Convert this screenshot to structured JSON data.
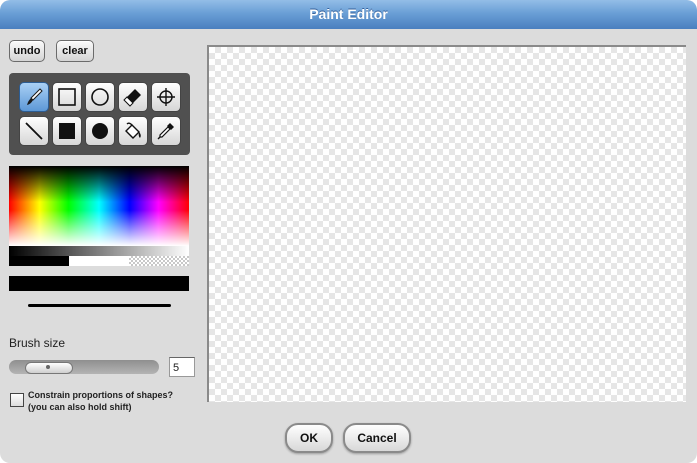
{
  "dialog": {
    "title": "Paint Editor"
  },
  "toolbar": {
    "undo_label": "undo",
    "clear_label": "clear"
  },
  "tools": [
    {
      "name": "brush",
      "icon": "brush-icon",
      "selected": true
    },
    {
      "name": "rectangle",
      "icon": "rectangle-outline-icon"
    },
    {
      "name": "ellipse",
      "icon": "ellipse-outline-icon"
    },
    {
      "name": "eraser",
      "icon": "eraser-icon"
    },
    {
      "name": "rotation-center",
      "icon": "crosshair-icon"
    },
    {
      "name": "line",
      "icon": "line-icon"
    },
    {
      "name": "filled-rectangle",
      "icon": "filled-rectangle-icon"
    },
    {
      "name": "filled-ellipse",
      "icon": "filled-ellipse-icon"
    },
    {
      "name": "paint-bucket",
      "icon": "paint-bucket-icon"
    },
    {
      "name": "eyedropper",
      "icon": "eyedropper-icon"
    }
  ],
  "palette": {
    "current_color": "#000000",
    "swatches": [
      "#000000",
      "#ffffff",
      "transparent"
    ]
  },
  "brush": {
    "label": "Brush size",
    "size": "5"
  },
  "constrain": {
    "label_line1": "Constrain proportions of shapes?",
    "label_line2": "(you can also hold shift)",
    "checked": false
  },
  "footer": {
    "ok_label": "OK",
    "cancel_label": "Cancel"
  },
  "colors": {
    "titlebar": "#6a9fd6",
    "dialog_background": "#dcdcdc",
    "selected_tool": "#5d98d6"
  }
}
